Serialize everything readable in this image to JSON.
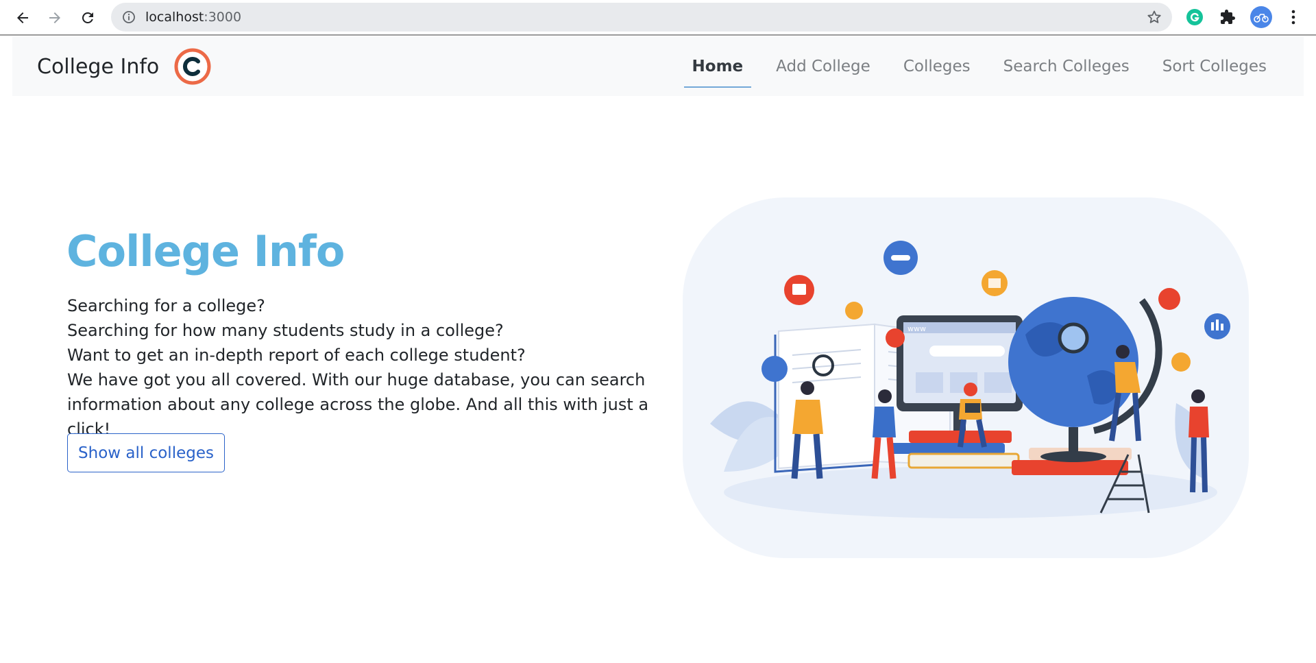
{
  "browser": {
    "url_host": "localhost",
    "url_port": ":3000"
  },
  "navbar": {
    "brand": "College Info",
    "links": [
      {
        "label": "Home",
        "active": true
      },
      {
        "label": "Add College"
      },
      {
        "label": "Colleges"
      },
      {
        "label": "Search Colleges"
      },
      {
        "label": "Sort Colleges"
      }
    ]
  },
  "hero": {
    "title": "College Info",
    "lines": [
      "Searching for a college?",
      "Searching for how many students study in a college?",
      "Want to get an in-depth report of each college student?",
      "We have got you all covered. With our huge database, you can search",
      "information about any college across the globe. And all this with just a click!"
    ],
    "button": "Show all colleges",
    "illustration_screen_text": "www"
  },
  "colors": {
    "title": "#5eb3df",
    "accent": "#2a62c9",
    "logo_ring": "#ec6a47",
    "logo_letter": "#0e2e3b"
  }
}
